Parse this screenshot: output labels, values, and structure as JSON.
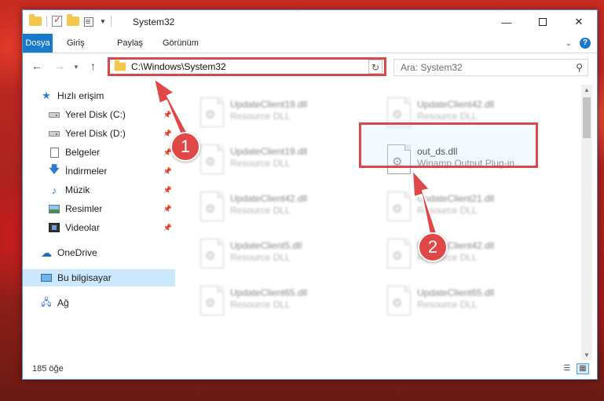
{
  "window": {
    "title": "System32"
  },
  "ribbon": {
    "tabs": [
      "Dosya",
      "Giriş",
      "Paylaş",
      "Görünüm"
    ]
  },
  "address": {
    "path": "C:\\Windows\\System32",
    "search_placeholder": "Ara: System32"
  },
  "sidebar": {
    "items": [
      {
        "label": "Hızlı erişim",
        "icon": "star-icon"
      },
      {
        "label": "Yerel Disk (C:)",
        "icon": "disk-icon",
        "pinned": true
      },
      {
        "label": "Yerel Disk (D:)",
        "icon": "disk-icon",
        "pinned": true
      },
      {
        "label": "Belgeler",
        "icon": "documents-icon",
        "pinned": true
      },
      {
        "label": "İndirmeler",
        "icon": "download-icon",
        "pinned": true
      },
      {
        "label": "Müzik",
        "icon": "music-icon",
        "pinned": true
      },
      {
        "label": "Resimler",
        "icon": "pictures-icon",
        "pinned": true
      },
      {
        "label": "Videolar",
        "icon": "videos-icon",
        "pinned": true
      },
      {
        "label": "OneDrive",
        "icon": "cloud-icon"
      },
      {
        "label": "Bu bilgisayar",
        "icon": "computer-icon",
        "selected": true
      },
      {
        "label": "Ağ",
        "icon": "network-icon"
      }
    ]
  },
  "files": [
    {
      "name": "UpdateClient19.dll",
      "desc": "Resource DLL"
    },
    {
      "name": "UpdateClient42.dll",
      "desc": "Resource DLL"
    },
    {
      "name": "UpdateClient19.dll",
      "desc": "Resource DLL"
    },
    {
      "name": "out_ds.dll",
      "desc": "Winamp Output Plug-in",
      "highlighted": true
    },
    {
      "name": "UpdateClient42.dll",
      "desc": "Resource DLL"
    },
    {
      "name": "UpdateClient21.dll",
      "desc": "Resource DLL"
    },
    {
      "name": "UpdateClient5.dll",
      "desc": "Resource DLL"
    },
    {
      "name": "UpdateClient42.dll",
      "desc": "Resource DLL"
    },
    {
      "name": "UpdateClient65.dll",
      "desc": "Resource DLL"
    },
    {
      "name": "UpdateClient65.dll",
      "desc": "Resource DLL"
    }
  ],
  "status": {
    "count": "185 öğe"
  },
  "annotations": {
    "step1": "1",
    "step2": "2",
    "color": "#e04848"
  }
}
